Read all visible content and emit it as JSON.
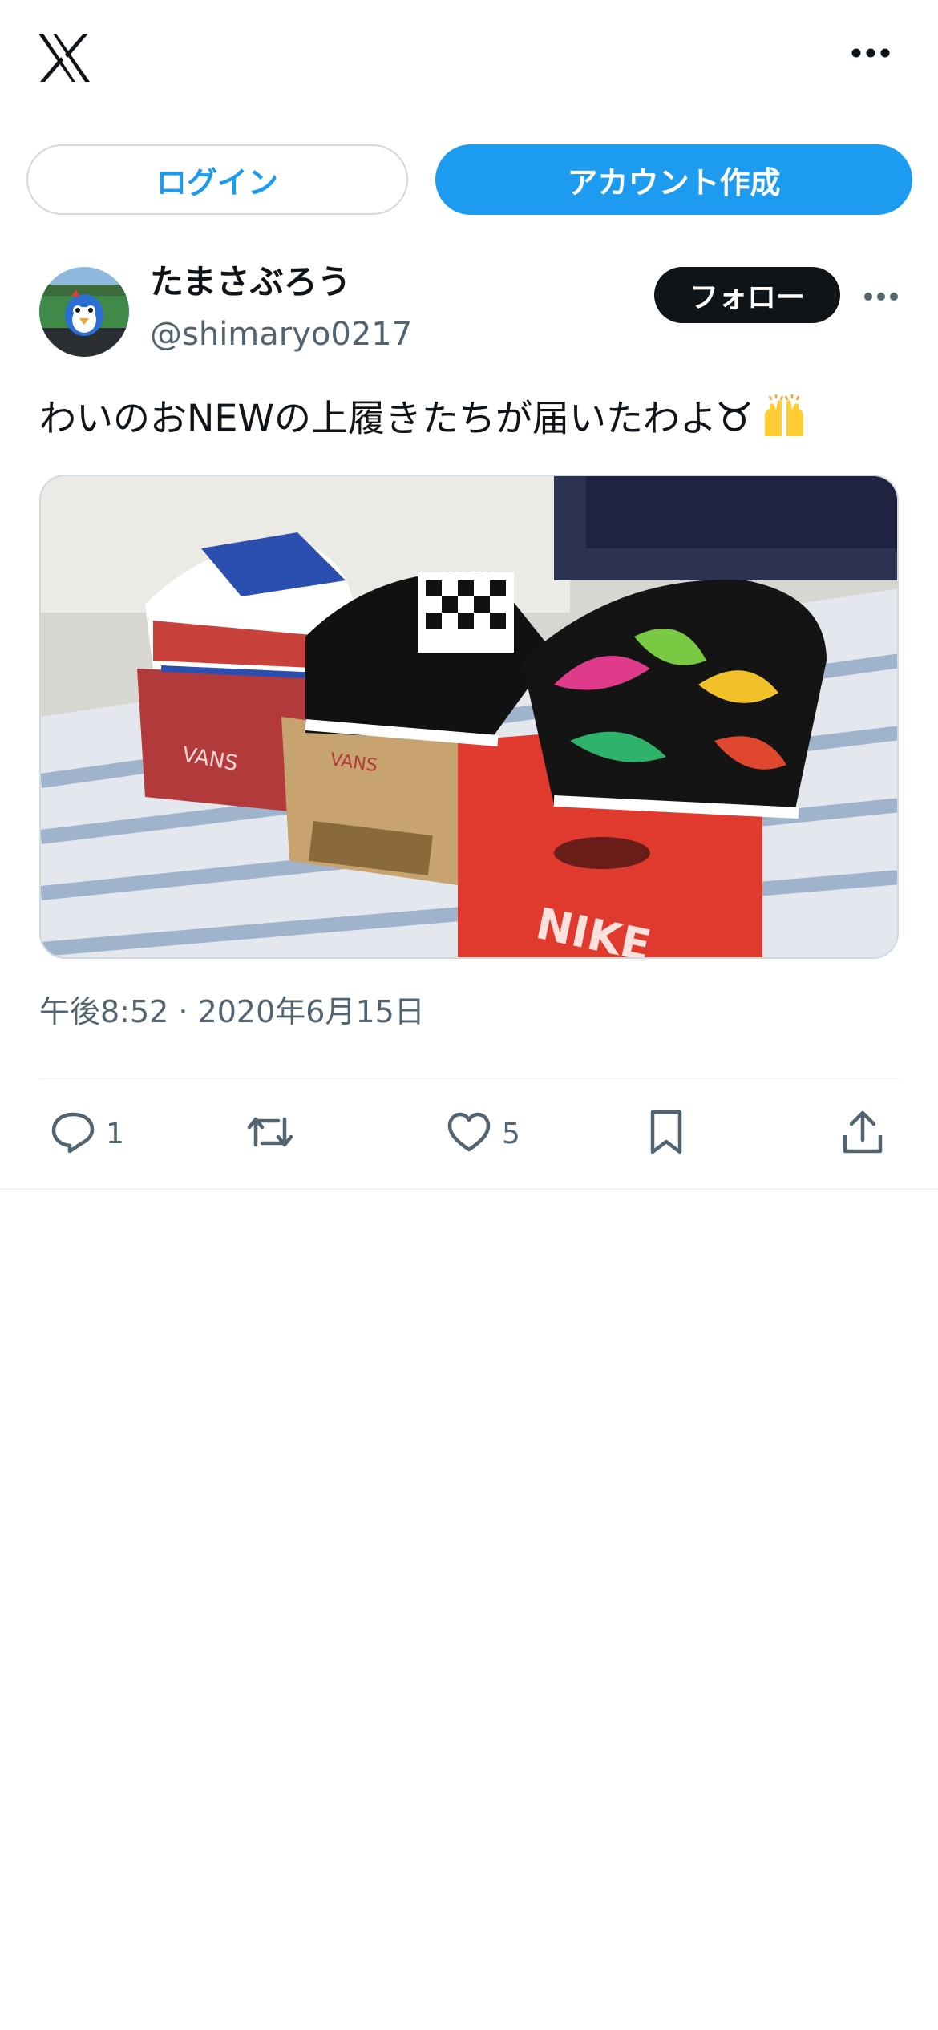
{
  "header": {
    "logo_icon": "x-logo-icon",
    "more_icon": "more-horizontal-icon"
  },
  "auth": {
    "login_label": "ログイン",
    "signup_label": "アカウント作成"
  },
  "author": {
    "display_name": "たまさぶろう",
    "handle": "@shimaryo0217",
    "follow_label": "フォロー"
  },
  "post": {
    "text": "わいのおNEWの上履きたちが届いたわよ",
    "emojis": [
      "taurus-sign-icon",
      "raising-hands-icon"
    ],
    "image_content": [
      "VANS",
      "NIKE"
    ],
    "timestamp": "午後8:52 · 2020年6月15日"
  },
  "actions": {
    "reply_count": "1",
    "retweet_count": "",
    "like_count": "5"
  },
  "colors": {
    "accent": "#1d9bf0",
    "text": "#0f1419",
    "secondary": "#536471",
    "border": "#cfd9de"
  }
}
